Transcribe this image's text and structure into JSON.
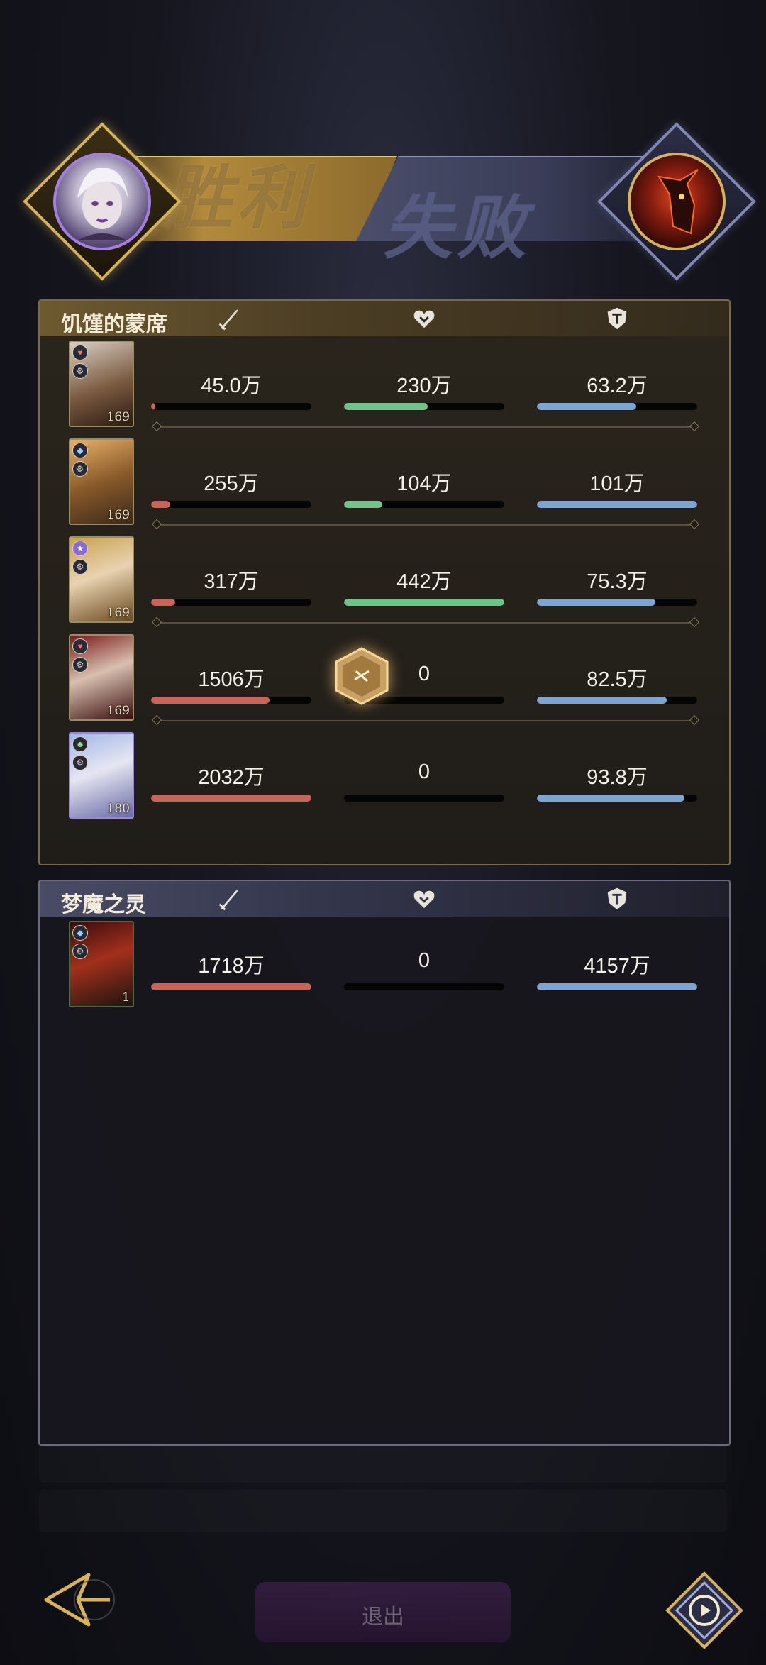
{
  "result": {
    "win_text": "胜利",
    "lose_text": "失败"
  },
  "stat_icons": {
    "damage": "sword-icon",
    "healing": "heart-icon",
    "tanking": "shield-icon"
  },
  "colors": {
    "damage": "#c8645a",
    "healing": "#72c28c",
    "tanking": "#7ea5d2",
    "gold": "#d7b25c"
  },
  "team": {
    "name": "饥馑的蒙席",
    "members": [
      {
        "level": "169",
        "damage": "45.0万",
        "damage_pct": 0.02,
        "healing": "230万",
        "healing_pct": 0.52,
        "tanking": "63.2万",
        "tanking_pct": 0.62
      },
      {
        "level": "169",
        "damage": "255万",
        "damage_pct": 0.12,
        "healing": "104万",
        "healing_pct": 0.24,
        "tanking": "101万",
        "tanking_pct": 1.0
      },
      {
        "level": "169",
        "damage": "317万",
        "damage_pct": 0.15,
        "healing": "442万",
        "healing_pct": 1.0,
        "tanking": "75.3万",
        "tanking_pct": 0.74
      },
      {
        "level": "169",
        "damage": "1506万",
        "damage_pct": 0.74,
        "healing": "0",
        "healing_pct": 0,
        "tanking": "82.5万",
        "tanking_pct": 0.81
      },
      {
        "level": "180",
        "damage": "2032万",
        "damage_pct": 1.0,
        "healing": "0",
        "healing_pct": 0,
        "tanking": "93.8万",
        "tanking_pct": 0.92
      }
    ]
  },
  "enemy": {
    "name": "梦魔之灵",
    "members": [
      {
        "level": "1",
        "damage": "1718万",
        "damage_pct": 1.0,
        "healing": "0",
        "healing_pct": 0,
        "tanking": "4157万",
        "tanking_pct": 1.0
      }
    ]
  },
  "buttons": {
    "back": "back-arrow-icon",
    "replay": "replay-icon",
    "center_label": "退出"
  }
}
